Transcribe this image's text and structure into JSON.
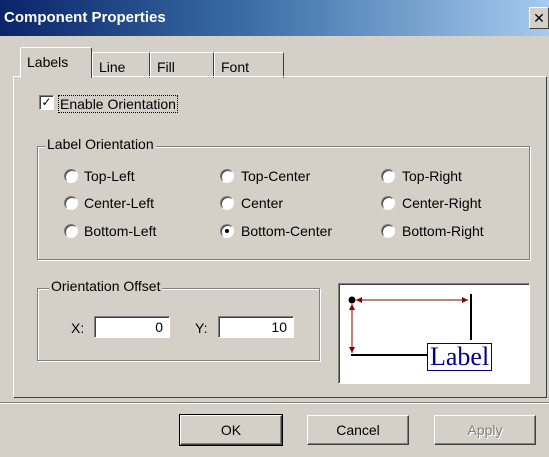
{
  "window": {
    "title": "Component Properties",
    "close_glyph": "✕"
  },
  "tabs": [
    {
      "label": "Labels",
      "active": true
    },
    {
      "label": "Line",
      "active": false
    },
    {
      "label": "Fill",
      "active": false
    },
    {
      "label": "Font",
      "active": false
    }
  ],
  "enable_orientation": {
    "label": "Enable Orientation",
    "checked": true,
    "check_glyph": "✓"
  },
  "label_orientation": {
    "title": "Label Orientation",
    "options": [
      "Top-Left",
      "Top-Center",
      "Top-Right",
      "Center-Left",
      "Center",
      "Center-Right",
      "Bottom-Left",
      "Bottom-Center",
      "Bottom-Right"
    ],
    "selected": "Bottom-Center"
  },
  "orientation_offset": {
    "title": "Orientation Offset",
    "x_label": "X:",
    "x_value": "0",
    "y_label": "Y:",
    "y_value": "10"
  },
  "preview": {
    "label_text": "Label"
  },
  "buttons": {
    "ok": "OK",
    "cancel": "Cancel",
    "apply": "Apply"
  },
  "colors": {
    "title_bar_start": "#0a246a",
    "title_bar_end": "#a6caf0",
    "preview_line": "#8b0000",
    "preview_label": "#00008b"
  }
}
